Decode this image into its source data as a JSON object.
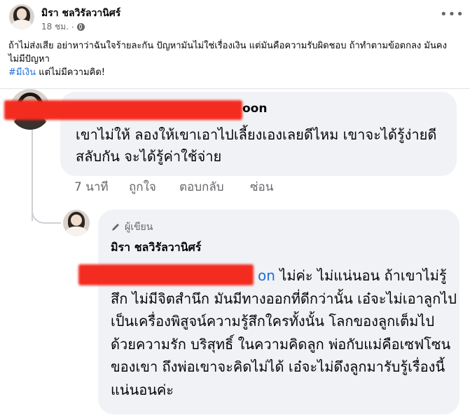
{
  "post": {
    "author": "มิรา ชลวิรัลวานิศร์",
    "time": "18 ชม.",
    "body": "ถ้าไม่ส่งเสีย อย่าหาว่าฉันใจร้ายละกัน ปัญหามันไม่ใช่เรื่องเงิน แต่มันคือความรับผิดชอบ ถ้าทำตามข้อตกลง มันคงไม่มีปัญหา",
    "hashtag": "#มีเงิน",
    "hashtag_rest": " แต่ไม่มีความคิด!",
    "more_icon": "more-dots-icon"
  },
  "comment1": {
    "name_visible": "oon",
    "text": "เขาไม่ให้ ลองให้เขาเอาไปเลี้ยงเองเลยดีไหม เขาจะได้รู้ง่ายดีสลับกัน จะได้รู้ค่าใช้จ่าย",
    "time": "7 นาที",
    "like": "ถูกใจ",
    "reply": "ตอบกลับ",
    "hide": "ซ่อน"
  },
  "comment2": {
    "badge": "ผู้เขียน",
    "name": "มิรา ชลวิรัลวานิศร์",
    "tag_tail": "on",
    "text_first": " ไม่ค่ะ ไม่แน่นอน ถ้าเขาไม่รู้สึก ไม่มีจิตสำนึก มันมีทางออกที่ดีกว่านั้น เอ๋จะไม่เอาลูกไปเป็นเครื่องพิสูจน์ความรู้สึกใครทั้งนั้น โลกของลูกเต็มไปด้วยความรัก บริสุทธิ์ ในความคิดลูก พ่อกับแม่คือเซฟโซนของเขา ถึงพ่อเขาจะคิดไม่ได้ เอ๋จะไม่ดึงลูกมารับรู้เรื่องนี้แน่นอนค่ะ"
  },
  "colors": {
    "hashtag": "#216fdb",
    "bubble": "#f0f2f5",
    "redaction": "#f42b1f",
    "meta": "#65676b"
  }
}
